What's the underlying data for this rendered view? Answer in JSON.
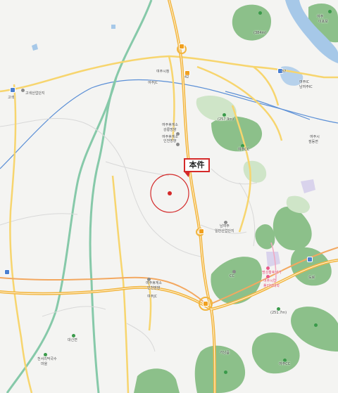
{
  "map": {
    "callout_label": "本件",
    "labels": {
      "industrial_complex": "고색산업단지",
      "gosaek": "고색",
      "ic_label_top": "여주JC",
      "hall_top": "여주시청",
      "service_area_1": "여주휴게소",
      "service_area_2": "강릉방향",
      "service_area_3": "여주휴게소",
      "service_area_4": "인천방향",
      "mountain_1": "(257.9m)",
      "cc_1": "여주CC",
      "cc_2": "남여주",
      "cc_3": "일반산업단지",
      "ic_south_1": "여주휴게소",
      "ic_south_2": "인천방향",
      "ic_south_3": "여주JC",
      "pink_1": "명성황후생가",
      "pink_2": "여주시립",
      "pink_3": "폴리텍대학",
      "mountain_2": "(251.7m)",
      "cc_3b": "CC",
      "hill_south": "여주CC",
      "school_1": "대신면",
      "school_2": "천서리막국수",
      "school_3": "마을",
      "town_south": "가남읍",
      "ic_right": "여주IC",
      "ic_right_2": "남여주IC",
      "ic_far_right": "여주시",
      "ic_far_right_2": "점동면",
      "north_peak": "(384m)",
      "north_right_1": "여주",
      "north_right_2": "이포보",
      "right_hill": "도로",
      "road_num_1": "42",
      "road_num_2": "37"
    },
    "colors": {
      "marker": "#d42a2a",
      "circle": "#d42a2a",
      "expressway": "#f2b53f",
      "major_road": "#f7d56e",
      "river": "#a6c8e8",
      "railway": "#5b8fd6",
      "green_area": "#8cc08a",
      "park": "#9ccf9a"
    },
    "icons": [
      "marker-dot-icon",
      "interchange-icon",
      "mountain-peak-icon",
      "school-icon"
    ]
  }
}
